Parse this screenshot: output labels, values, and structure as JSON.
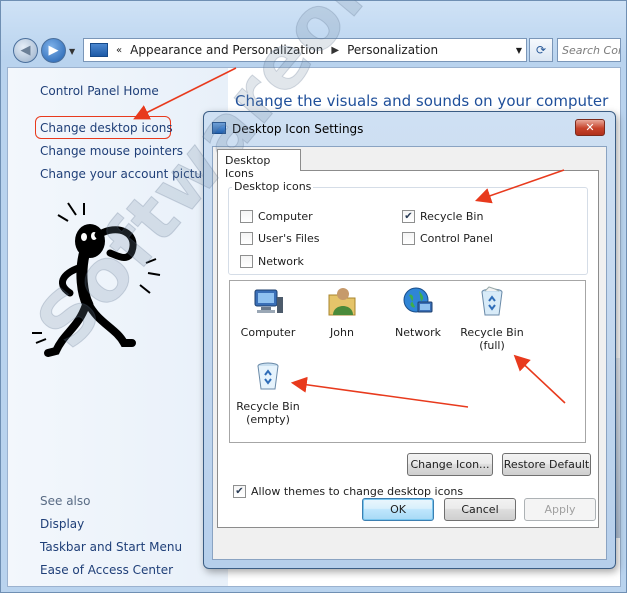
{
  "explorer": {
    "breadcrumb": [
      "Appearance and Personalization",
      "Personalization"
    ],
    "search_placeholder": "Search Cont",
    "left_links": {
      "home": "Control Panel Home",
      "desktop_icons": "Change desktop icons",
      "mouse_pointers": "Change mouse pointers",
      "account_picture": "Change your account picture",
      "see_also": "See also",
      "display": "Display",
      "taskbar": "Taskbar and Start Menu",
      "ease": "Ease of Access Center"
    },
    "main_title": "Change the visuals and sounds on your computer"
  },
  "dialog": {
    "title": "Desktop Icon Settings",
    "close_glyph": "✕",
    "tab": "Desktop Icons",
    "group_label": "Desktop icons",
    "checkboxes": [
      {
        "label": "Computer",
        "checked": false
      },
      {
        "label": "User's Files",
        "checked": false
      },
      {
        "label": "Network",
        "checked": false
      },
      {
        "label": "Recycle Bin",
        "checked": true
      },
      {
        "label": "Control Panel",
        "checked": false
      }
    ],
    "icons": [
      {
        "label": "Computer",
        "icon": "computer-icon"
      },
      {
        "label": "John",
        "icon": "user-folder-icon"
      },
      {
        "label": "Network",
        "icon": "network-globe-icon"
      },
      {
        "label": "Recycle Bin (full)",
        "line1": "Recycle Bin",
        "line2": "(full)",
        "icon": "recycle-bin-full-icon"
      },
      {
        "label": "Recycle Bin (empty)",
        "line1": "Recycle Bin",
        "line2": "(empty)",
        "icon": "recycle-bin-empty-icon"
      }
    ],
    "buttons": {
      "change_icon": "Change Icon...",
      "restore_default": "Restore Default",
      "ok": "OK",
      "cancel": "Cancel",
      "apply": "Apply"
    },
    "allow_themes": {
      "label": "Allow themes to change desktop icons",
      "checked": true
    }
  },
  "watermark": "Softwareok.com",
  "colors": {
    "link": "#1f3f78",
    "title_blue": "#1f4f9a",
    "annotation_red": "#e83a1d"
  }
}
